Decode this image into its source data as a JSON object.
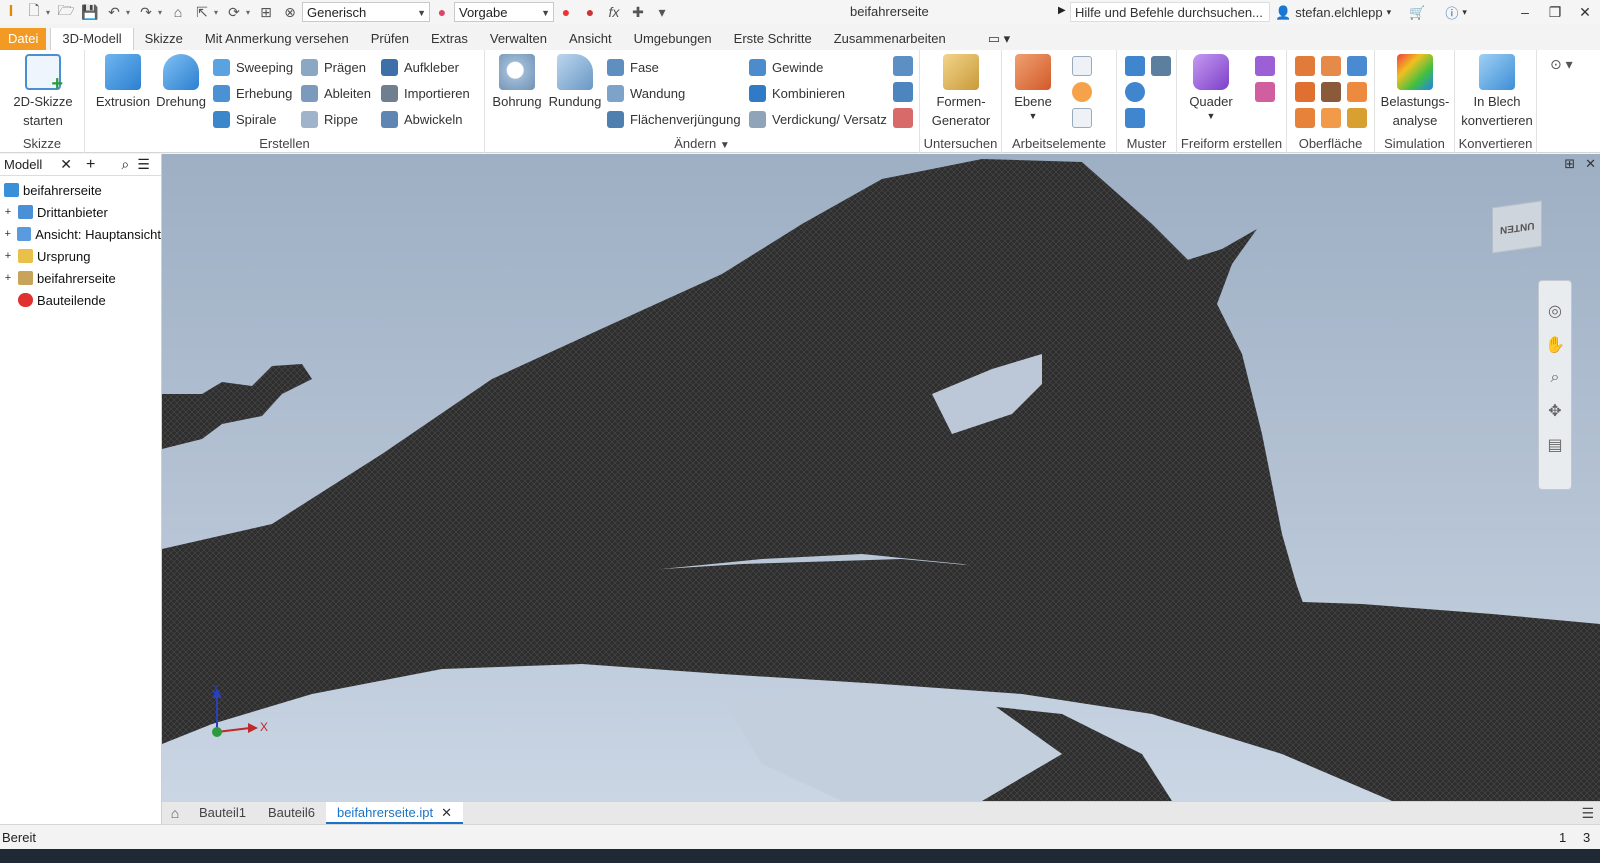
{
  "window": {
    "title": "beifahrerseite",
    "search_placeholder": "Hilfe und Befehle durchsuchen...",
    "user": "stefan.elchlepp",
    "combo_material": "Generisch",
    "combo_appearance": "Vorgabe",
    "fx_label": "fx"
  },
  "tabs": [
    "Datei",
    "3D-Modell",
    "Skizze",
    "Mit Anmerkung versehen",
    "Prüfen",
    "Extras",
    "Verwalten",
    "Ansicht",
    "Umgebungen",
    "Erste Schritte",
    "Zusammenarbeiten"
  ],
  "ribbon": {
    "skizze": {
      "label": "Skizze",
      "start": "2D-Skizze starten"
    },
    "erstellen": {
      "label": "Erstellen",
      "extrusion": "Extrusion",
      "drehung": "Drehung",
      "sweeping": "Sweeping",
      "erhebung": "Erhebung",
      "spirale": "Spirale",
      "praegen": "Prägen",
      "ableiten": "Ableiten",
      "rippe": "Rippe",
      "aufkleber": "Aufkleber",
      "importieren": "Importieren",
      "abwickeln": "Abwickeln"
    },
    "aendern": {
      "label": "Ändern",
      "bohrung": "Bohrung",
      "rundung": "Rundung",
      "fase": "Fase",
      "wandung": "Wandung",
      "flaechenverjuengung": "Flächenverjüngung",
      "gewinde": "Gewinde",
      "kombinieren": "Kombinieren",
      "verdickung": "Verdickung/ Versatz"
    },
    "untersuchen": {
      "label": "Untersuchen",
      "formen_generator": "Formen-Generator"
    },
    "arbeitselemente": {
      "label": "Arbeitselemente",
      "ebene": "Ebene"
    },
    "muster": {
      "label": "Muster"
    },
    "freiform": {
      "label": "Freiform erstellen",
      "quader": "Quader"
    },
    "oberflaeche": {
      "label": "Oberfläche"
    },
    "simulation": {
      "label": "Simulation",
      "belastung": "Belastungs-analyse"
    },
    "konvertieren": {
      "label": "Konvertieren",
      "in_blech": "In Blech konvertieren"
    }
  },
  "browser": {
    "tab": "Modell",
    "items": [
      {
        "label": "beifahrerseite",
        "icon": "part-icon",
        "color": "#3a8fd9"
      },
      {
        "label": "Drittanbieter",
        "icon": "thirdparty-icon",
        "color": "#4a90d9"
      },
      {
        "label": "Ansicht: Hauptansicht",
        "icon": "view-icon",
        "color": "#4a90d9"
      },
      {
        "label": "Ursprung",
        "icon": "folder-icon",
        "color": "#e8c04a"
      },
      {
        "label": "beifahrerseite",
        "icon": "mesh-icon",
        "color": "#c9a35a"
      },
      {
        "label": "Bauteilende",
        "icon": "end-of-part-icon",
        "color": "#e03030"
      }
    ]
  },
  "viewport": {
    "viewcube_label": "UNTEN",
    "axis_x": "X",
    "axis_z": "Z"
  },
  "doctabs": [
    "Bauteil1",
    "Bauteil6",
    "beifahrerseite.ipt"
  ],
  "status": {
    "text": "Bereit",
    "n1": "1",
    "n2": "3"
  },
  "colors": {
    "accent": "#1a73c8",
    "file_tab": "#f39a24",
    "mesh": "#2b2b2b"
  }
}
